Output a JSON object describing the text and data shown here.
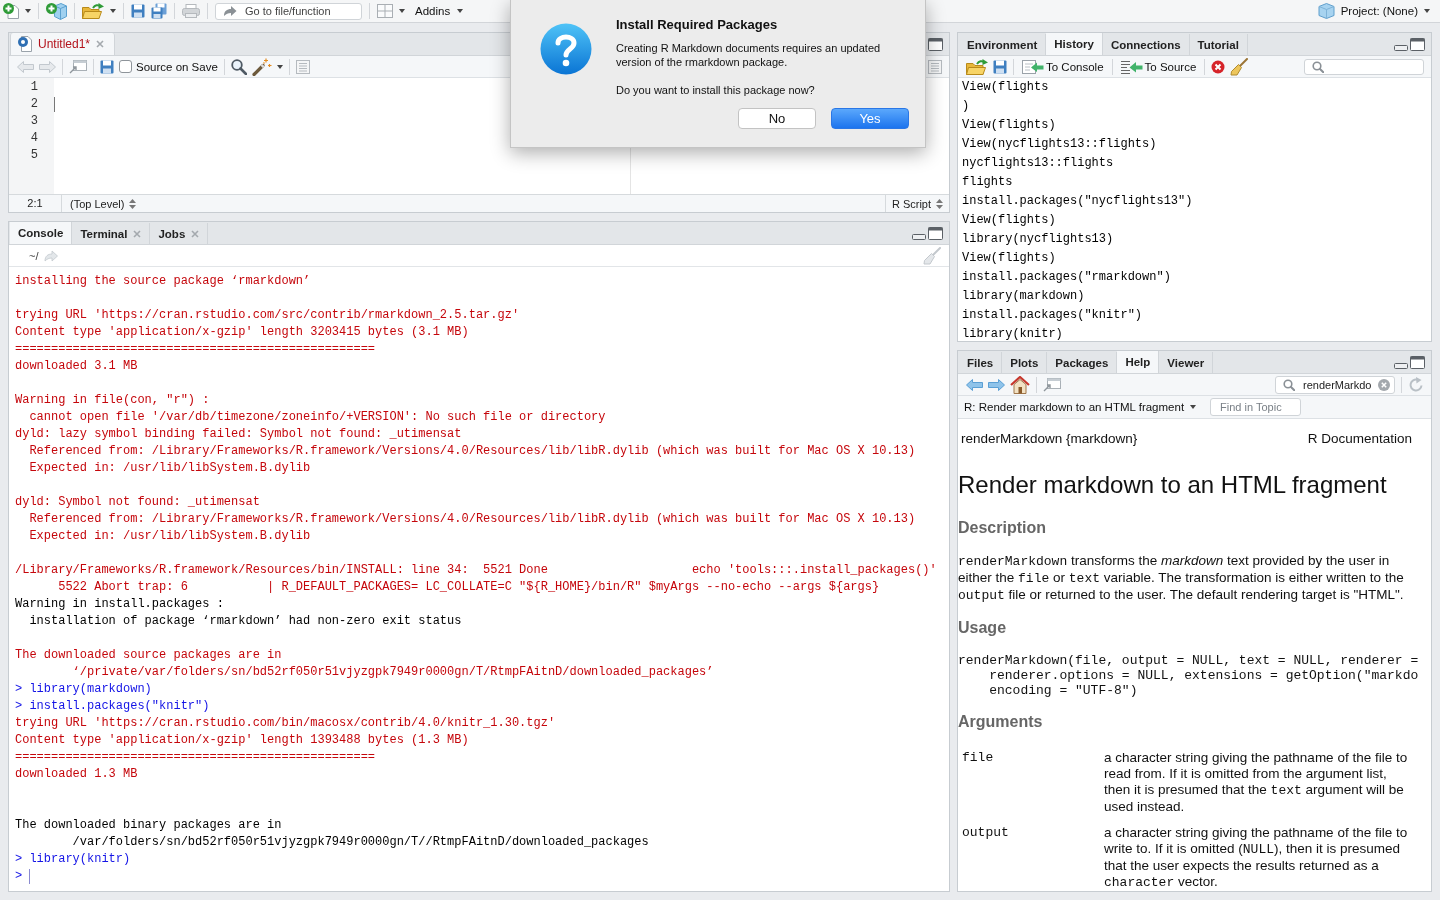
{
  "toolbar": {
    "goto": {
      "placeholder": "Go to file/function"
    },
    "addins": "Addins",
    "project": "Project: (None)"
  },
  "editor": {
    "tabs": [
      {
        "label": "Untitled1*",
        "selected": true,
        "modified": true
      }
    ],
    "source_on_save": {
      "label": "Source on Save",
      "checked": false
    },
    "lines": [
      {
        "number": "1",
        "cursor": false
      },
      {
        "number": "2",
        "cursor": true
      },
      {
        "number": "3",
        "cursor": false
      },
      {
        "number": "4",
        "cursor": false
      },
      {
        "number": "5",
        "cursor": false
      }
    ],
    "status": {
      "position": "2:1",
      "scope": "(Top Level)",
      "file_type": "R Script"
    }
  },
  "console": {
    "tabs": [
      {
        "label": "Console",
        "selected": true,
        "closable": false
      },
      {
        "label": "Terminal",
        "selected": false,
        "closable": true
      },
      {
        "label": "Jobs",
        "selected": false,
        "closable": true
      }
    ],
    "path": "~/",
    "lines": [
      {
        "kind": "message",
        "text": "installing the source package ‘rmarkdown’"
      },
      {
        "kind": "blank"
      },
      {
        "kind": "message",
        "text": "trying URL 'https://cran.rstudio.com/src/contrib/rmarkdown_2.5.tar.gz'"
      },
      {
        "kind": "message",
        "text": "Content type 'application/x-gzip' length 3203415 bytes (3.1 MB)"
      },
      {
        "kind": "message",
        "text": "=================================================="
      },
      {
        "kind": "message",
        "text": "downloaded 3.1 MB"
      },
      {
        "kind": "blank"
      },
      {
        "kind": "message",
        "text": "Warning in file(con, \"r\") :"
      },
      {
        "kind": "message",
        "text": "  cannot open file '/var/db/timezone/zoneinfo/+VERSION': No such file or directory"
      },
      {
        "kind": "message",
        "text": "dyld: lazy symbol binding failed: Symbol not found: _utimensat"
      },
      {
        "kind": "message",
        "text": "  Referenced from: /Library/Frameworks/R.framework/Versions/4.0/Resources/lib/libR.dylib (which was built for Mac OS X 10.13)"
      },
      {
        "kind": "message",
        "text": "  Expected in: /usr/lib/libSystem.B.dylib"
      },
      {
        "kind": "blank"
      },
      {
        "kind": "message",
        "text": "dyld: Symbol not found: _utimensat"
      },
      {
        "kind": "message",
        "text": "  Referenced from: /Library/Frameworks/R.framework/Versions/4.0/Resources/lib/libR.dylib (which was built for Mac OS X 10.13)"
      },
      {
        "kind": "message",
        "text": "  Expected in: /usr/lib/libSystem.B.dylib"
      },
      {
        "kind": "blank"
      },
      {
        "kind": "message",
        "text": "/Library/Frameworks/R.framework/Resources/bin/INSTALL: line 34:  5521 Done                    echo 'tools:::.install_packages()'"
      },
      {
        "kind": "message",
        "text": "      5522 Abort trap: 6           | R_DEFAULT_PACKAGES= LC_COLLATE=C \"${R_HOME}/bin/R\" $myArgs --no-echo --args ${args}"
      },
      {
        "kind": "output",
        "text": "Warning in install.packages :"
      },
      {
        "kind": "output",
        "text": "  installation of package ‘rmarkdown’ had non-zero exit status"
      },
      {
        "kind": "blank"
      },
      {
        "kind": "message",
        "text": "The downloaded source packages are in"
      },
      {
        "kind": "message",
        "text": "        ‘/private/var/folders/sn/bd52rf050r51vjyzgpk7949r0000gn/T/RtmpFAitnD/downloaded_packages’"
      },
      {
        "kind": "input",
        "text": "> library(markdown)"
      },
      {
        "kind": "input",
        "text": "> install.packages(\"knitr\")"
      },
      {
        "kind": "message",
        "text": "trying URL 'https://cran.rstudio.com/bin/macosx/contrib/4.0/knitr_1.30.tgz'"
      },
      {
        "kind": "message",
        "text": "Content type 'application/x-gzip' length 1393488 bytes (1.3 MB)"
      },
      {
        "kind": "message",
        "text": "=================================================="
      },
      {
        "kind": "message",
        "text": "downloaded 1.3 MB"
      },
      {
        "kind": "blank"
      },
      {
        "kind": "blank"
      },
      {
        "kind": "output",
        "text": "The downloaded binary packages are in"
      },
      {
        "kind": "output",
        "text": "        /var/folders/sn/bd52rf050r51vjyzgpk7949r0000gn/T//RtmpFAitnD/downloaded_packages"
      },
      {
        "kind": "input",
        "text": "> library(knitr)"
      },
      {
        "kind": "prompt",
        "text": ">"
      }
    ]
  },
  "environment_pane": {
    "tabs": [
      {
        "label": "Environment",
        "selected": false
      },
      {
        "label": "History",
        "selected": true
      },
      {
        "label": "Connections",
        "selected": false
      },
      {
        "label": "Tutorial",
        "selected": false
      }
    ],
    "toolbar": {
      "to_console": "To Console",
      "to_source": "To Source"
    },
    "history": [
      "View(flights",
      ")",
      "View(flights)",
      "View(nycflights13::flights)",
      "nycflights13::flights",
      "flights",
      "install.packages(\"nycflights13\")",
      "View(flights)",
      "library(nycflights13)",
      "View(flights)",
      "install.packages(\"rmarkdown\")",
      "library(markdown)",
      "install.packages(\"knitr\")",
      "library(knitr)"
    ]
  },
  "help_pane": {
    "tabs": [
      {
        "label": "Files",
        "selected": false
      },
      {
        "label": "Plots",
        "selected": false
      },
      {
        "label": "Packages",
        "selected": false
      },
      {
        "label": "Help",
        "selected": true
      },
      {
        "label": "Viewer",
        "selected": false
      }
    ],
    "search": {
      "value": "renderMarkdo"
    },
    "topic": "R: Render markdown to an HTML fragment",
    "find": {
      "placeholder": "Find in Topic"
    },
    "doc": {
      "name": "renderMarkdown {markdown}",
      "source": "R Documentation",
      "title": "Render markdown to an HTML fragment",
      "sections": [
        {
          "kind": "paragraph",
          "heading": "Description",
          "content": [
            {
              "kind": "code",
              "text": "renderMarkdown"
            },
            {
              "kind": "text",
              "text": " transforms the "
            },
            {
              "kind": "em",
              "text": "markdown"
            },
            {
              "kind": "text",
              "text": " text provided by the user in either the "
            },
            {
              "kind": "code",
              "text": "file"
            },
            {
              "kind": "text",
              "text": " or "
            },
            {
              "kind": "code",
              "text": "text"
            },
            {
              "kind": "text",
              "text": " variable. The transformation is either written to the "
            },
            {
              "kind": "code",
              "text": "output"
            },
            {
              "kind": "text",
              "text": " file or returned to the user. The default rendering target is \"HTML\"."
            }
          ]
        },
        {
          "kind": "code",
          "heading": "Usage",
          "lines": [
            "renderMarkdown(file, output = NULL, text = NULL, renderer =",
            "    renderer.options = NULL, extensions = getOption(\"markdo",
            "    encoding = \"UTF-8\")"
          ]
        },
        {
          "kind": "arguments",
          "heading": "Arguments",
          "items": [
            {
              "term": "file",
              "description": [
                {
                  "kind": "text",
                  "text": "a character string giving the pathname of the file to read from. If it is omitted from the argument list, then it is presumed that the "
                },
                {
                  "kind": "code",
                  "text": "text"
                },
                {
                  "kind": "text",
                  "text": " argument will be used instead."
                }
              ]
            },
            {
              "term": "output",
              "description": [
                {
                  "kind": "text",
                  "text": "a character string giving the pathname of the file to write to. If it is omitted ("
                },
                {
                  "kind": "code",
                  "text": "NULL"
                },
                {
                  "kind": "text",
                  "text": "), then it is presumed that the user expects the results returned as a "
                },
                {
                  "kind": "code",
                  "text": "character"
                },
                {
                  "kind": "text",
                  "text": " vector."
                }
              ]
            }
          ]
        }
      ]
    }
  },
  "dialog": {
    "title": "Install Required Packages",
    "message": "Creating R Markdown documents requires an updated version of the rmarkdown package.",
    "question": "Do you want to install this package now?",
    "buttons": [
      {
        "label": "No",
        "default": false
      },
      {
        "label": "Yes",
        "default": true
      }
    ]
  }
}
